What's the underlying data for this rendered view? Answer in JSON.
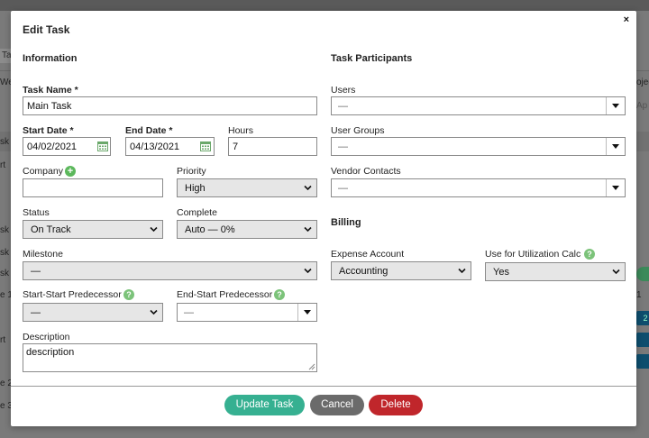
{
  "background": {
    "tab": "Ta",
    "left_texts": [
      "We",
      "sk",
      "rt",
      "sk",
      "sk",
      "sk",
      "e 1",
      "rt",
      "e 2",
      "e 3"
    ],
    "right_texts": [
      "ojec",
      "Ap"
    ],
    "chip_texts": [
      "2",
      "1"
    ]
  },
  "modal": {
    "title": "Edit Task",
    "close": "×",
    "information_heading": "Information",
    "participants_heading": "Task Participants",
    "billing_heading": "Billing"
  },
  "form": {
    "task_name": {
      "label": "Task Name *",
      "value": "Main Task"
    },
    "start_date": {
      "label": "Start Date *",
      "value": "04/02/2021"
    },
    "end_date": {
      "label": "End Date *",
      "value": "04/13/2021"
    },
    "hours": {
      "label": "Hours",
      "value": "7"
    },
    "company": {
      "label": "Company",
      "value": ""
    },
    "priority": {
      "label": "Priority",
      "value": "High"
    },
    "status": {
      "label": "Status",
      "value": "On Track"
    },
    "complete": {
      "label": "Complete",
      "value": "Auto — 0%"
    },
    "milestone": {
      "label": "Milestone",
      "value": "—"
    },
    "start_start": {
      "label": "Start-Start Predecessor",
      "value": "—"
    },
    "end_start": {
      "label": "End-Start Predecessor",
      "value": "—"
    },
    "description": {
      "label": "Description",
      "value": "description"
    },
    "users": {
      "label": "Users",
      "value": "—"
    },
    "user_groups": {
      "label": "User Groups",
      "value": "—"
    },
    "vendor_contacts": {
      "label": "Vendor Contacts",
      "value": "—"
    },
    "expense_account": {
      "label": "Expense Account",
      "value": "Accounting"
    },
    "utilization": {
      "label": "Use for Utilization Calc",
      "value": "Yes"
    }
  },
  "buttons": {
    "update": "Update Task",
    "cancel": "Cancel",
    "delete": "Delete"
  },
  "colors": {
    "update": "#36b091",
    "cancel": "#6b6b6b",
    "delete": "#c0262b",
    "help": "#7cc37a"
  }
}
